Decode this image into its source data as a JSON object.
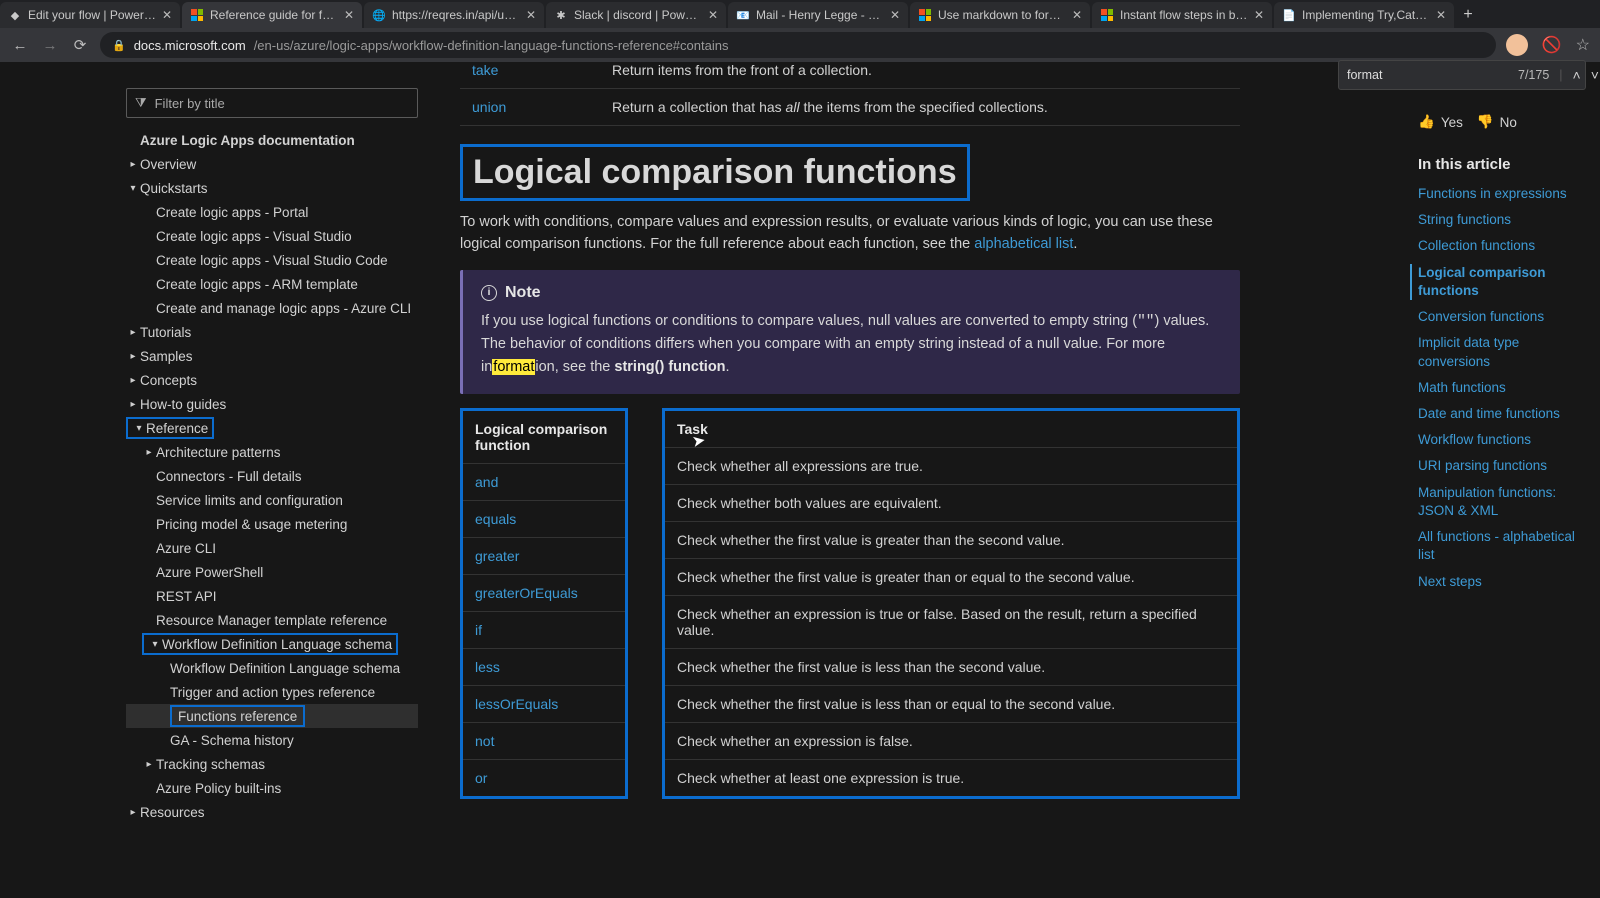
{
  "browser": {
    "tabs": [
      {
        "title": "Edit your flow | Power Aut"
      },
      {
        "title": "Reference guide for functio",
        "active": true
      },
      {
        "title": "https://reqres.in/api/users?"
      },
      {
        "title": "Slack | discord | Power Aut"
      },
      {
        "title": "Mail - Henry Legge - Outl"
      },
      {
        "title": "Use markdown to format P"
      },
      {
        "title": "Instant flow steps in busine"
      },
      {
        "title": "Implementing Try,Catch an"
      }
    ],
    "url_host": "docs.microsoft.com",
    "url_path": "/en-us/azure/logic-apps/workflow-definition-language-functions-reference#contains"
  },
  "find": {
    "query": "format",
    "count": "7/175"
  },
  "leftnav": {
    "filter_placeholder": "Filter by title",
    "items": [
      {
        "lvl": 0,
        "label": "Azure Logic Apps documentation"
      },
      {
        "lvl": 1,
        "caret": ">",
        "label": "Overview"
      },
      {
        "lvl": 1,
        "caret": "v",
        "label": "Quickstarts"
      },
      {
        "lvl": 2,
        "label": "Create logic apps - Portal"
      },
      {
        "lvl": 2,
        "label": "Create logic apps - Visual Studio"
      },
      {
        "lvl": 2,
        "label": "Create logic apps - Visual Studio Code"
      },
      {
        "lvl": 2,
        "label": "Create logic apps - ARM template"
      },
      {
        "lvl": 2,
        "label": "Create and manage logic apps - Azure CLI"
      },
      {
        "lvl": 1,
        "caret": ">",
        "label": "Tutorials"
      },
      {
        "lvl": 1,
        "caret": ">",
        "label": "Samples"
      },
      {
        "lvl": 1,
        "caret": ">",
        "label": "Concepts"
      },
      {
        "lvl": 1,
        "caret": ">",
        "label": "How-to guides"
      },
      {
        "lvl": 1,
        "caret": "v",
        "label": "Reference",
        "hi": true
      },
      {
        "lvl": 2,
        "caret": ">",
        "label": "Architecture patterns"
      },
      {
        "lvl": 2,
        "label": "Connectors - Full details"
      },
      {
        "lvl": 2,
        "label": "Service limits and configuration"
      },
      {
        "lvl": 2,
        "label": "Pricing model & usage metering"
      },
      {
        "lvl": 2,
        "label": "Azure CLI"
      },
      {
        "lvl": 2,
        "label": "Azure PowerShell"
      },
      {
        "lvl": 2,
        "label": "REST API"
      },
      {
        "lvl": 2,
        "label": "Resource Manager template reference"
      },
      {
        "lvl": 2,
        "caret": "v",
        "label": "Workflow Definition Language schema",
        "hi": true
      },
      {
        "lvl": 3,
        "label": "Workflow Definition Language schema"
      },
      {
        "lvl": 3,
        "label": "Trigger and action types reference"
      },
      {
        "lvl": 3,
        "label": "Functions reference",
        "hi": true,
        "sel": true
      },
      {
        "lvl": 3,
        "label": "GA - Schema history"
      },
      {
        "lvl": 2,
        "caret": ">",
        "label": "Tracking schemas"
      },
      {
        "lvl": 2,
        "label": "Azure Policy built-ins"
      },
      {
        "lvl": 1,
        "caret": ">",
        "label": "Resources"
      }
    ]
  },
  "content": {
    "pre_rows": [
      {
        "fn": "take",
        "task": "Return items from the front of a collection."
      },
      {
        "fn": "union",
        "task_pre": "Return a collection that has ",
        "task_em": "all",
        "task_post": " the items from the specified collections."
      }
    ],
    "heading": "Logical comparison functions",
    "intro_a": "To work with conditions, compare values and expression results, or evaluate various kinds of logic, you can use these logical comparison functions. For the full reference about each function, see the ",
    "intro_link": "alphabetical list",
    "intro_b": ".",
    "note_label": "Note",
    "note_a": "If you use logical functions or conditions to compare values, null values are converted to empty string (",
    "note_code": "\"\"",
    "note_b": ") values. The behavior of conditions differs when you compare with an empty string instead of a null value. For more in",
    "note_mark": "format",
    "note_c": "ion, see the ",
    "note_strong": "string() function",
    "note_d": ".",
    "col_fn_header": "Logical comparison function",
    "col_task_header": "Task",
    "rows": [
      {
        "fn": "and",
        "task": "Check whether all expressions are true."
      },
      {
        "fn": "equals",
        "task": "Check whether both values are equivalent."
      },
      {
        "fn": "greater",
        "task": "Check whether the first value is greater than the second value."
      },
      {
        "fn": "greaterOrEquals",
        "task": "Check whether the first value is greater than or equal to the second value."
      },
      {
        "fn": "if",
        "task": "Check whether an expression is true or false. Based on the result, return a specified value."
      },
      {
        "fn": "less",
        "task": "Check whether the first value is less than the second value."
      },
      {
        "fn": "lessOrEquals",
        "task": "Check whether the first value is less than or equal to the second value."
      },
      {
        "fn": "not",
        "task": "Check whether an expression is false."
      },
      {
        "fn": "or",
        "task": "Check whether at least one expression is true."
      }
    ]
  },
  "rightrail": {
    "yes": "Yes",
    "no": "No",
    "heading": "In this article",
    "links": [
      {
        "label": "Functions in expressions"
      },
      {
        "label": "String functions"
      },
      {
        "label": "Collection functions"
      },
      {
        "label": "Logical comparison functions",
        "active": true
      },
      {
        "label": "Conversion functions"
      },
      {
        "label": "Implicit data type conversions"
      },
      {
        "label": "Math functions"
      },
      {
        "label": "Date and time functions"
      },
      {
        "label": "Workflow functions"
      },
      {
        "label": "URI parsing functions"
      },
      {
        "label": "Manipulation functions: JSON & XML"
      },
      {
        "label": "All functions - alphabetical list"
      },
      {
        "label": "Next steps"
      }
    ]
  }
}
